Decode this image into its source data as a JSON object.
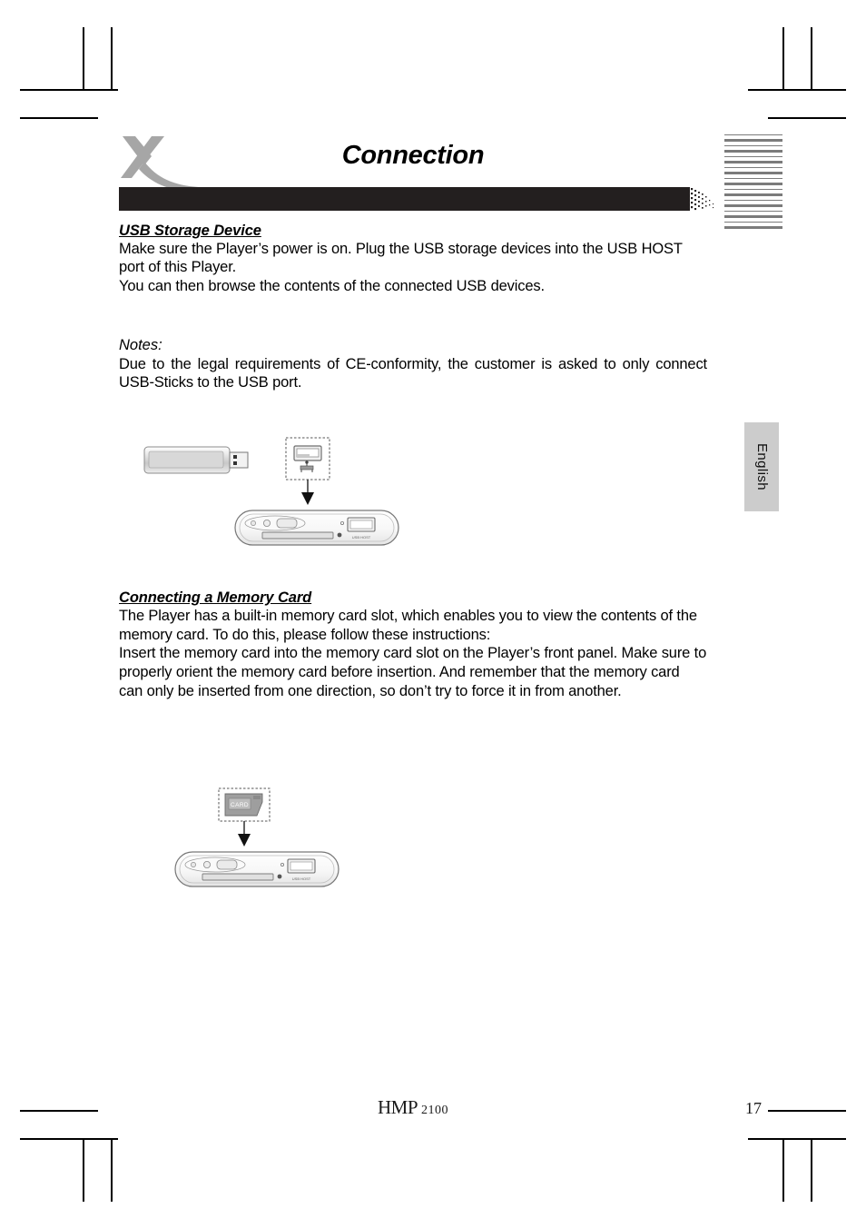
{
  "document": {
    "title": "Connection",
    "logo_icon": "x-brand-logo",
    "language_tab": "English"
  },
  "sections": [
    {
      "heading": "USB Storage Device",
      "paragraphs": [
        "Make sure the Player’s power is on. Plug the USB storage devices into the USB HOST port of this Player.",
        "You can then browse the contents of the connected USB devices."
      ]
    },
    {
      "heading": "Connecting a Memory Card",
      "paragraphs": [
        "The Player has a built-in memory card slot, which enables you to view the contents of the memory card. To do this, please follow these instructions:",
        "Insert the memory card into the memory card slot on the Player’s front panel. Make sure to properly orient the memory card before insertion. And remember that the memory card can only be inserted from one direction, so don’t try to force it in from another."
      ]
    }
  ],
  "notes": {
    "label": "Notes:",
    "text": "Due to the legal requirements of CE-conformity, the customer is asked to only connect USB-Sticks to the USB port."
  },
  "figures": {
    "usb": {
      "name": "usb-connection-diagram",
      "usb_stick_label": "",
      "port_callout": "usb-host-port",
      "arrow": "down-arrow",
      "panel_label": "player-front-panel"
    },
    "memory_card": {
      "name": "memory-card-insertion-diagram",
      "card_label": "CARD",
      "arrow": "down-arrow",
      "panel_label": "player-front-panel"
    }
  },
  "footer": {
    "model": "HMP",
    "model_number": "2100",
    "page_number": "17"
  },
  "colors": {
    "bar": "#231f1f",
    "logo_gray": "#a6a6a6",
    "tab_gray": "#cccccc",
    "stripe_gray": "#7b7b7b"
  }
}
